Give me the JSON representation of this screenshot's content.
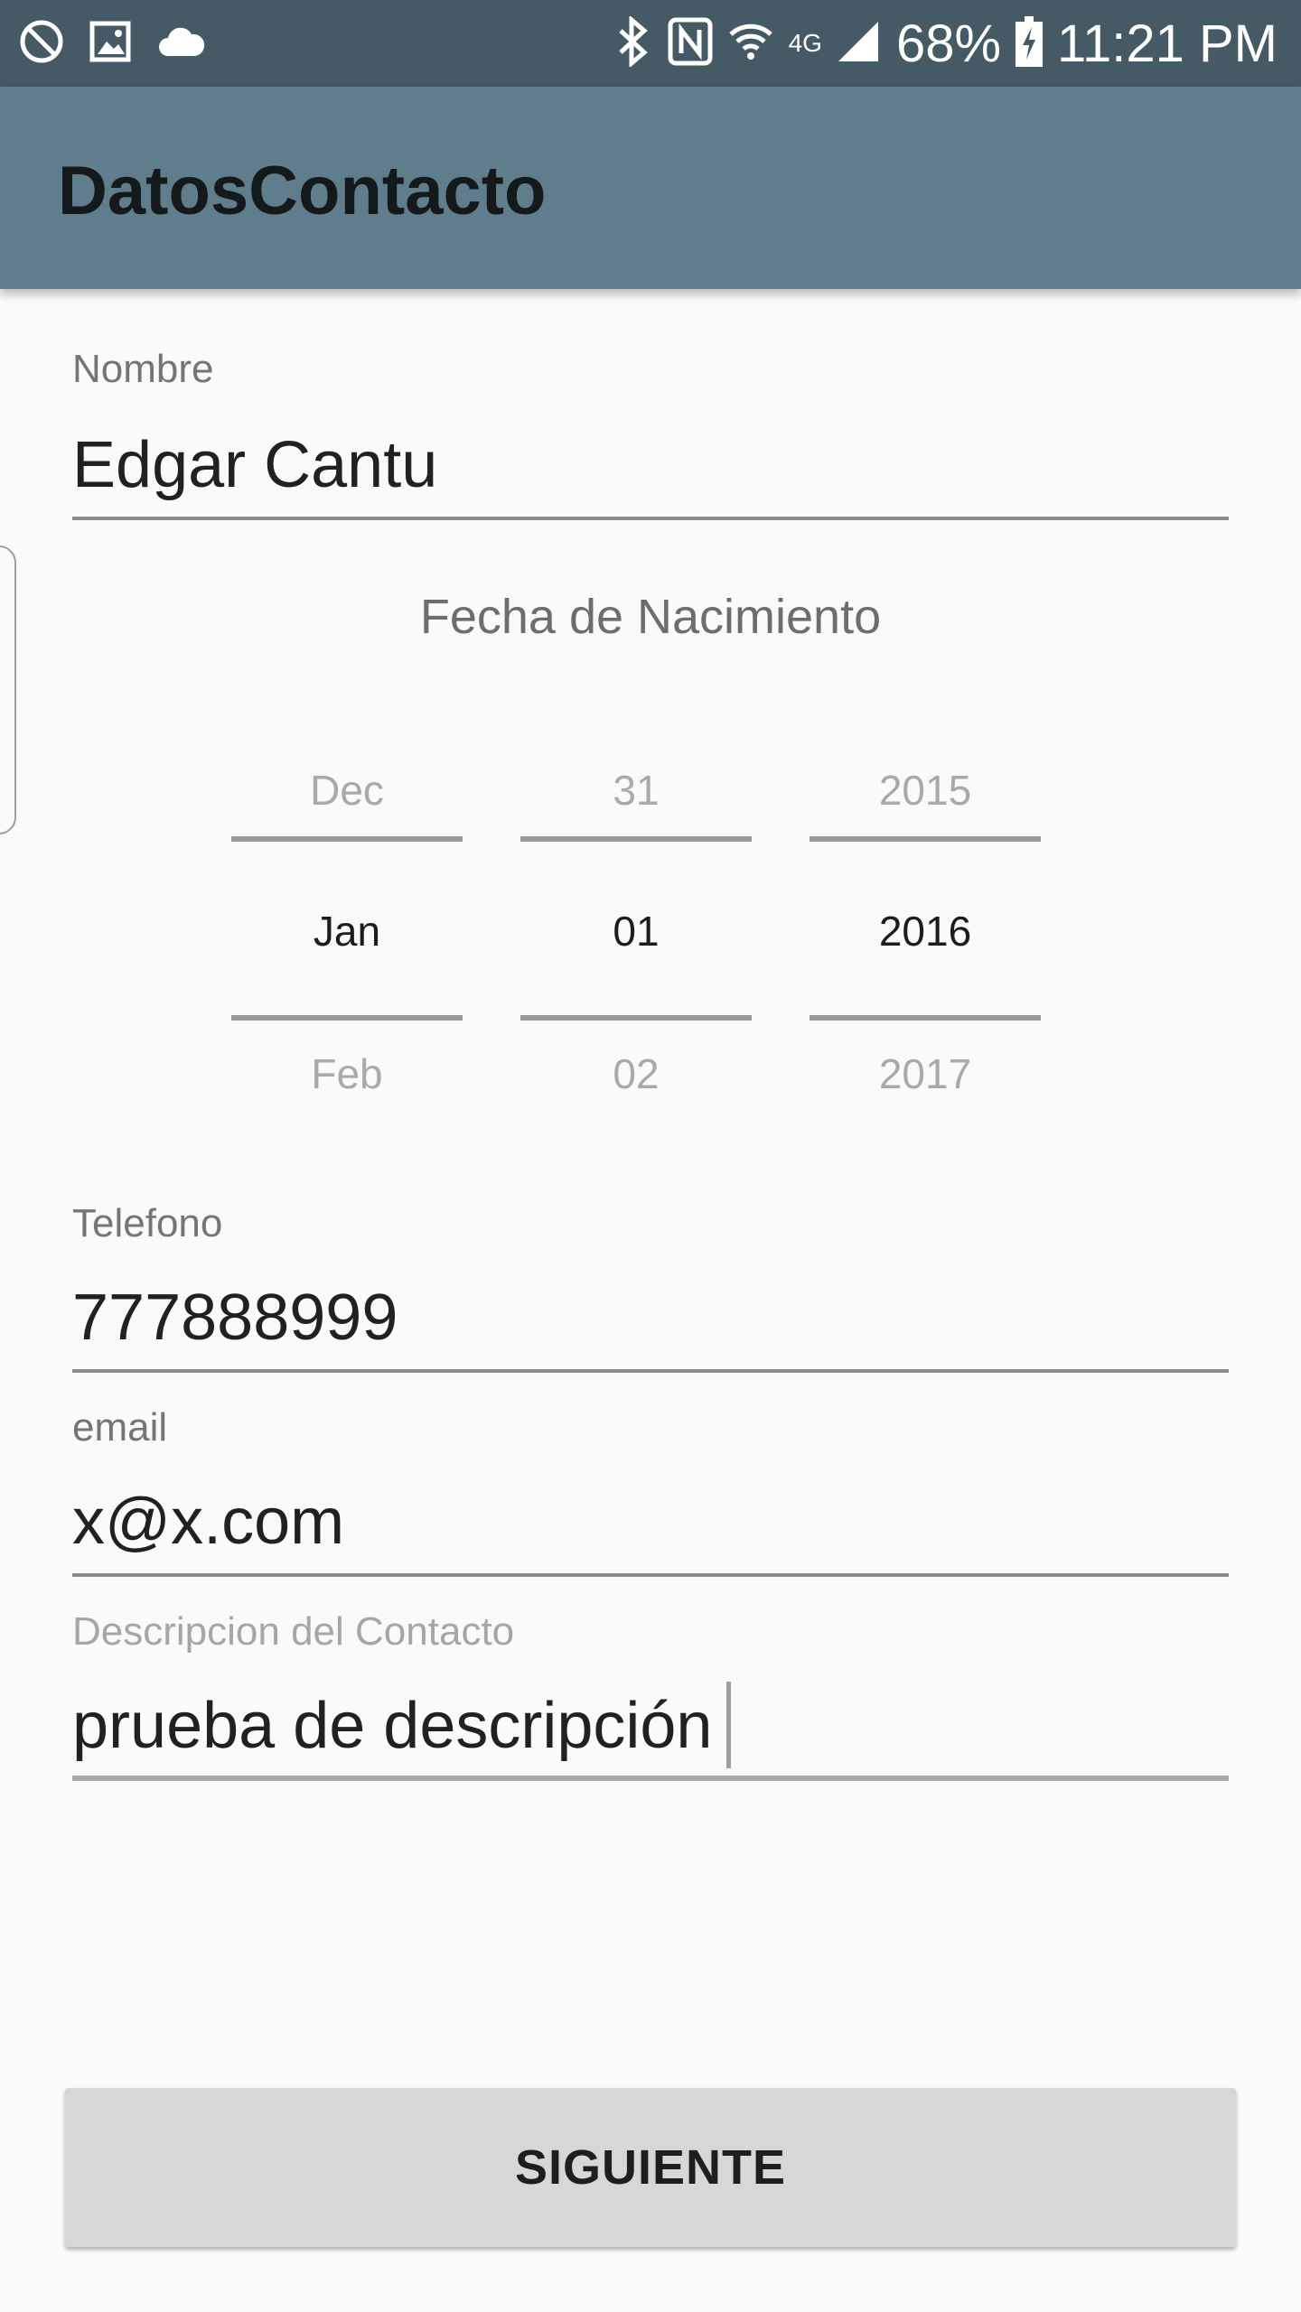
{
  "status_bar": {
    "left_icons": [
      "do-not-disturb-icon",
      "image-icon",
      "cloud-icon"
    ],
    "right_icons": [
      "bluetooth-icon",
      "nfc-icon",
      "wifi-icon",
      "signal-icon",
      "battery-charging-icon"
    ],
    "network_label": "4G",
    "battery_percent": "68%",
    "time": "11:21 PM"
  },
  "app_bar": {
    "title": "DatosContacto"
  },
  "form": {
    "nombre": {
      "label": "Nombre",
      "value": "Edgar Cantu"
    },
    "fecha": {
      "label": "Fecha de Nacimiento",
      "month": {
        "prev": "Dec",
        "selected": "Jan",
        "next": "Feb"
      },
      "day": {
        "prev": "31",
        "selected": "01",
        "next": "02"
      },
      "year": {
        "prev": "2015",
        "selected": "2016",
        "next": "2017"
      }
    },
    "telefono": {
      "label": "Telefono",
      "value": "777888999"
    },
    "email": {
      "label": "email",
      "value": "x@x.com"
    },
    "descripcion": {
      "label": "Descripcion del Contacto",
      "value": "prueba de descripción"
    }
  },
  "actions": {
    "next_label": "SIGUIENTE"
  }
}
